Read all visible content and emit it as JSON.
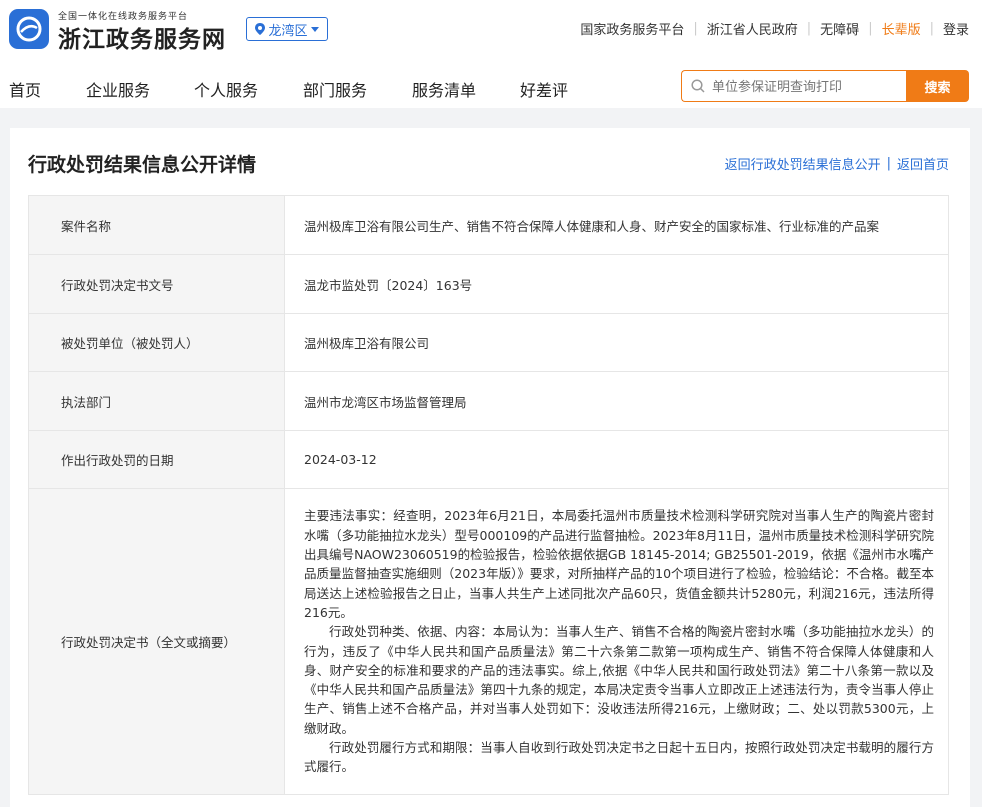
{
  "header": {
    "logo_small": "全国一体化在线政务服务平台",
    "logo_main": "浙江政务服务网",
    "region": "龙湾区",
    "links": [
      "国家政务服务平台",
      "浙江省人民政府",
      "无障碍",
      "长辈版",
      "登录"
    ]
  },
  "nav": [
    "首页",
    "企业服务",
    "个人服务",
    "部门服务",
    "服务清单",
    "好差评"
  ],
  "search": {
    "placeholder": "单位参保证明查询打印",
    "button": "搜索"
  },
  "page": {
    "title": "行政处罚结果信息公开详情",
    "back_link": "返回行政处罚结果信息公开",
    "home_link": "返回首页"
  },
  "rows": [
    {
      "label": "案件名称",
      "value": "温州极库卫浴有限公司生产、销售不符合保障人体健康和人身、财产安全的国家标准、行业标准的产品案"
    },
    {
      "label": "行政处罚决定书文号",
      "value": "温龙市监处罚〔2024〕163号"
    },
    {
      "label": "被处罚单位（被处罚人）",
      "value": "温州极库卫浴有限公司"
    },
    {
      "label": "执法部门",
      "value": "温州市龙湾区市场监督管理局"
    },
    {
      "label": "作出行政处罚的日期",
      "value": "2024-03-12"
    }
  ],
  "decision": {
    "label": "行政处罚决定书（全文或摘要）",
    "paragraphs": [
      "主要违法事实：经查明，2023年6月21日，本局委托温州市质量技术检测科学研究院对当事人生产的陶瓷片密封水嘴（多功能抽拉水龙头）型号000109的产品进行监督抽检。2023年8月11日，温州市质量技术检测科学研究院出具编号NAOW23060519的检验报告，检验依据依据GB 18145-2014; GB25501-2019，依据《温州市水嘴产品质量监督抽查实施细则（2023年版）》要求，对所抽样产品的10个项目进行了检验，检验结论：不合格。截至本局送达上述检验报告之日止，当事人共生产上述同批次产品60只，货值金额共计5280元，利润216元，违法所得216元。",
      "行政处罚种类、依据、内容：本局认为：当事人生产、销售不合格的陶瓷片密封水嘴（多功能抽拉水龙头）的行为，违反了《中华人民共和国产品质量法》第二十六条第二款第一项构成生产、销售不符合保障人体健康和人身、财产安全的标准和要求的产品的违法事实。综上,依据《中华人民共和国行政处罚法》第二十八条第一款以及《中华人民共和国产品质量法》第四十九条的规定，本局决定责令当事人立即改正上述违法行为，责令当事人停止生产、销售上述不合格产品，并对当事人处罚如下：没收违法所得216元，上缴财政；二、处以罚款5300元，上缴财政。",
      "行政处罚履行方式和期限：当事人自收到行政处罚决定书之日起十五日内，按照行政处罚决定书载明的履行方式履行。"
    ]
  },
  "colors": {
    "brand": "#2a6fd6",
    "accent": "#f07b16"
  }
}
